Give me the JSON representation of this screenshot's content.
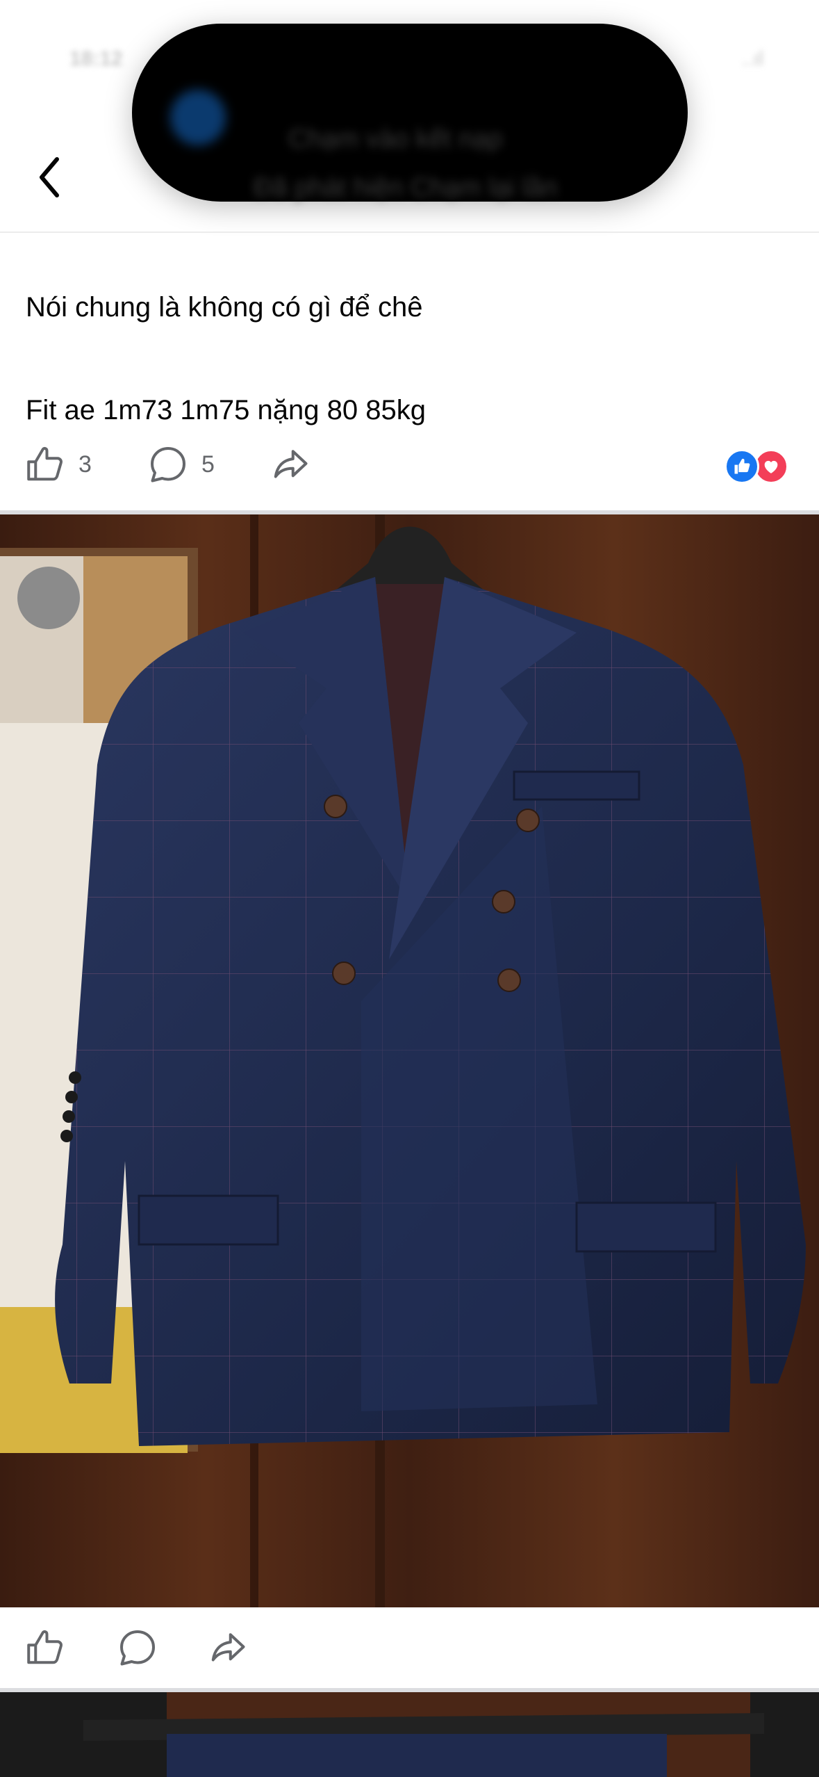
{
  "status_bar": {
    "time": "18:12",
    "right_indicators": "..ıl"
  },
  "dynamic_island": {
    "line1": "Chạm vào kết nạp",
    "line2": "Đã phát hiện Chạm lại lần"
  },
  "nav": {
    "back_icon": "chevron-left-icon"
  },
  "post": {
    "line1": "Nói chung là không có gì để chê",
    "line2": "Fit ae 1m73 1m75 nặng 80 85kg"
  },
  "actions": {
    "like_count": "3",
    "comment_count": "5",
    "icons": [
      "like-icon",
      "comment-icon",
      "share-icon"
    ],
    "reactions": [
      "like-reaction-icon",
      "love-reaction-icon"
    ]
  },
  "photo": {
    "subject": "navy double-breasted windowpane suit jacket on hanger",
    "colors": {
      "jacket": "#1f2a4e",
      "wood": "#4a2616",
      "like_blue": "#1877f2",
      "love_red": "#f33e58"
    }
  },
  "photo_actions": {
    "icons": [
      "like-icon",
      "comment-icon",
      "share-icon"
    ]
  }
}
